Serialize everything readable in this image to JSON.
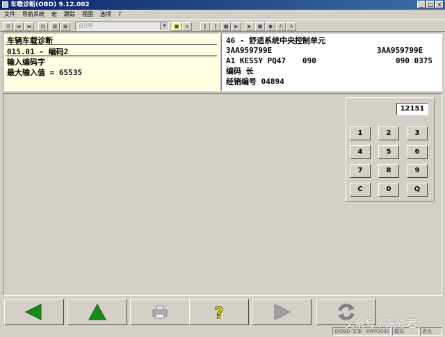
{
  "window": {
    "title": "车载诊断(OBD) 9.12.002",
    "minimize": "_",
    "maximize": "□",
    "close": "×"
  },
  "menu": [
    "文件",
    "导航系统",
    "宏",
    "跟踪",
    "视图",
    "选项",
    "?"
  ],
  "toolbar": {
    "combo_value": "自诊断"
  },
  "left_panel": {
    "title": "车辆车载诊断",
    "function": "015.01 - 编码2",
    "prompt": "输入编码字",
    "max_label": "最大输入值 = 65535"
  },
  "right_panel": {
    "module": "46 - 舒适系统中央控制单元",
    "part_left": "3AA959799E",
    "part_right": "3AA959799E",
    "component_left": "A1 KESSY PQ47",
    "component_mid": "090",
    "component_right": "090  0375",
    "coding": "编码 长",
    "dealer": "经销编号 04894"
  },
  "keypad": {
    "display_value": "12151",
    "keys": [
      "1",
      "2",
      "3",
      "4",
      "5",
      "6",
      "7",
      "8",
      "9",
      "C",
      "0",
      "Q"
    ]
  },
  "bottom_buttons": [
    {
      "name": "back",
      "icon": "arrow-left-icon",
      "color": "#1a8a1a"
    },
    {
      "name": "up",
      "icon": "arrow-up-icon",
      "color": "#1a8a1a"
    },
    {
      "name": "print",
      "icon": "printer-icon",
      "color": "#909090"
    },
    {
      "name": "help",
      "icon": "question-icon",
      "color": "#e8d800"
    },
    {
      "name": "forward",
      "icon": "arrow-right-icon",
      "color": "#909090"
    },
    {
      "name": "refresh",
      "icon": "refresh-icon",
      "color": "#909090"
    }
  ],
  "statusbar": {
    "version": "仅OBD-文本 · KWP2000",
    "mode": "模拟",
    "extra": "退出"
  },
  "watermark": "头条号 / 汽修君"
}
